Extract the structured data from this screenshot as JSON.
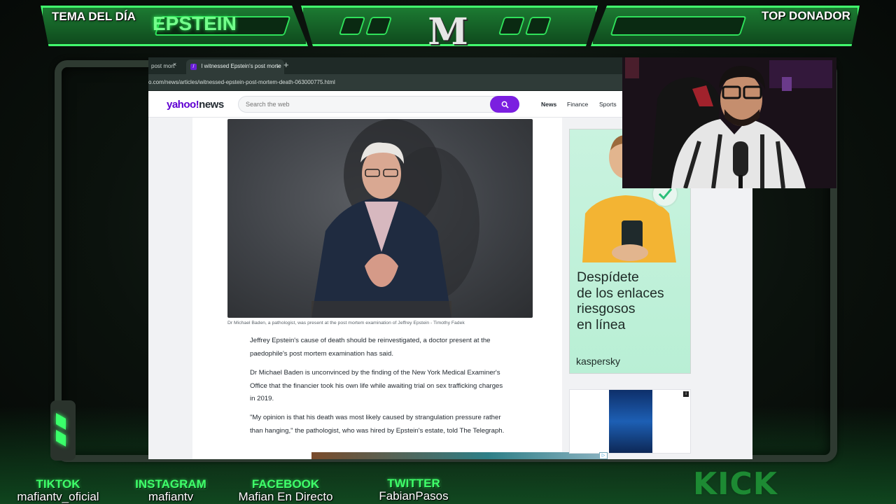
{
  "overlay": {
    "tema_label": "TEMA DEL DÍA",
    "tema_value": "EPSTEIN",
    "donador_label": "TOP DONADOR",
    "logo_letter": "M",
    "accent_color": "#3fff6a"
  },
  "browser": {
    "tabs": [
      {
        "title": "post mort",
        "close": "×"
      },
      {
        "title": "I witnessed Epstein's post morte",
        "close": "×",
        "favicon": "/"
      }
    ],
    "new_tab": "+",
    "url": "o.com/news/articles/witnessed-epstein-post-mortem-death-063000775.html"
  },
  "yahoo": {
    "logo_main": "yahoo!",
    "logo_sub": "news",
    "search_placeholder": "Search the web",
    "search_icon": "search-icon",
    "nav": [
      "News",
      "Finance",
      "Sports"
    ]
  },
  "article": {
    "caption": "Dr Michael Baden, a pathologist, was present at the post mortem examination of Jeffrey Epstein - Timothy Fadek",
    "paragraphs": [
      "Jeffrey Epstein's cause of death should be reinvestigated, a doctor present at the paedophile's post mortem examination has said.",
      "Dr Michael Baden is unconvinced by the finding of the New York Medical Examiner's Office that the financier took his own life while awaiting trial on sex trafficking charges in 2019.",
      "\"My opinion is that his death was most likely caused by strangulation pressure rather than hanging,\" the pathologist, who was hired by Epstein's estate, told The Telegraph."
    ]
  },
  "ad": {
    "headline_lines": [
      "Despídete",
      "de los enlaces",
      "riesgosos",
      "en línea"
    ],
    "brand": "kaspersky"
  },
  "socials": [
    {
      "label": "TIKTOK",
      "handle": "mafiantv_oficial"
    },
    {
      "label": "INSTAGRAM",
      "handle": "mafiantv"
    },
    {
      "label": "FACEBOOK",
      "handle": "Mafian En Directo"
    },
    {
      "label": "TWITTER",
      "handle": "FabianPasos"
    }
  ],
  "kick": "KICK"
}
